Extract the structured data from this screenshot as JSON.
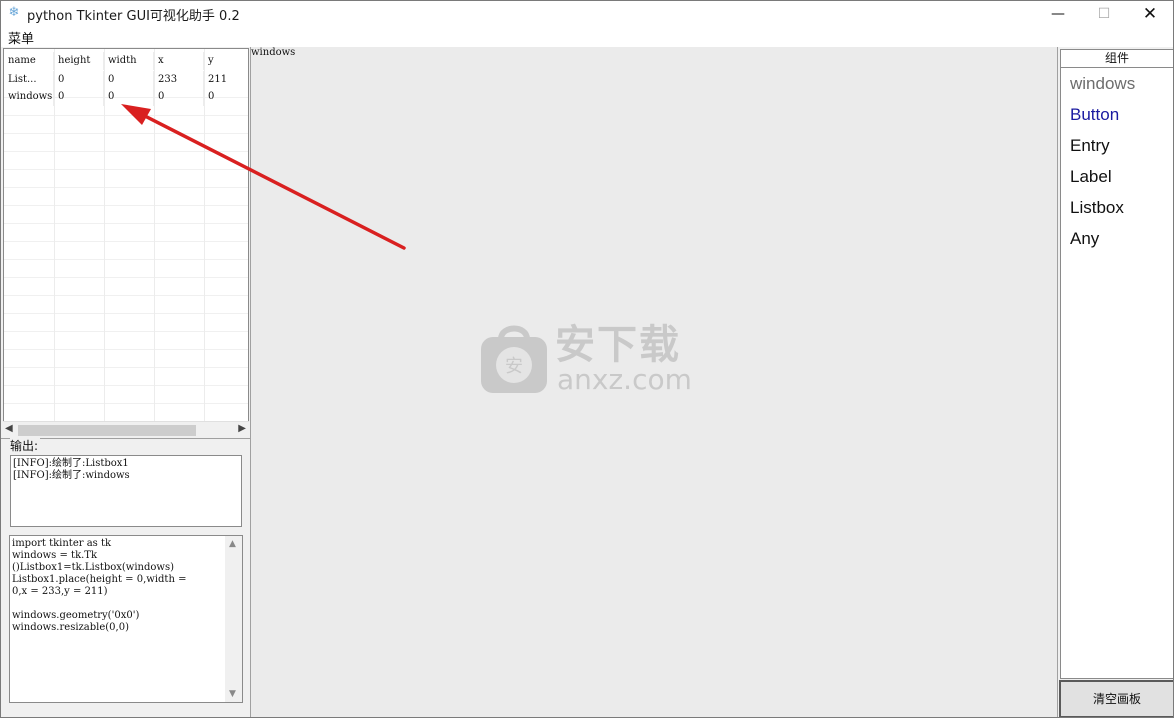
{
  "window": {
    "title": "python Tkinter GUI可视化助手 0.2",
    "icon": "snowflake-icon",
    "controls": {
      "minimize": "—",
      "maximize": "☐",
      "close": "✕"
    }
  },
  "menubar": {
    "items": [
      {
        "label": "菜单"
      }
    ]
  },
  "table": {
    "headers": [
      "name",
      "height",
      "width",
      "x",
      "y"
    ],
    "rows": [
      [
        "List...",
        "0",
        "0",
        "233",
        "211"
      ],
      [
        "windows",
        "0",
        "0",
        "0",
        "0"
      ]
    ]
  },
  "output": {
    "label": "输出:",
    "lines": [
      "[INFO]:绘制了:Listbox1",
      "[INFO]:绘制了:windows"
    ]
  },
  "code": {
    "text": "import tkinter as tk\nwindows = tk.Tk\n()Listbox1=tk.Listbox(windows)\nListbox1.place(height = 0,width =\n0,x = 233,y = 211)\n\nwindows.geometry('0x0')\nwindows.resizable(0,0)"
  },
  "canvas": {
    "label": "windows"
  },
  "watermark": {
    "cn": "安下载",
    "en": "anxz.com",
    "badge": "安"
  },
  "components": {
    "header": "组件",
    "items": [
      {
        "label": "windows",
        "state": "disabled"
      },
      {
        "label": "Button",
        "state": "selected"
      },
      {
        "label": "Entry",
        "state": "normal"
      },
      {
        "label": "Label",
        "state": "normal"
      },
      {
        "label": "Listbox",
        "state": "normal"
      },
      {
        "label": "Any",
        "state": "normal"
      }
    ],
    "clear_button": "清空画板"
  },
  "colors": {
    "annotation_arrow": "#d92020",
    "selected_item": "#1a1aa0"
  }
}
